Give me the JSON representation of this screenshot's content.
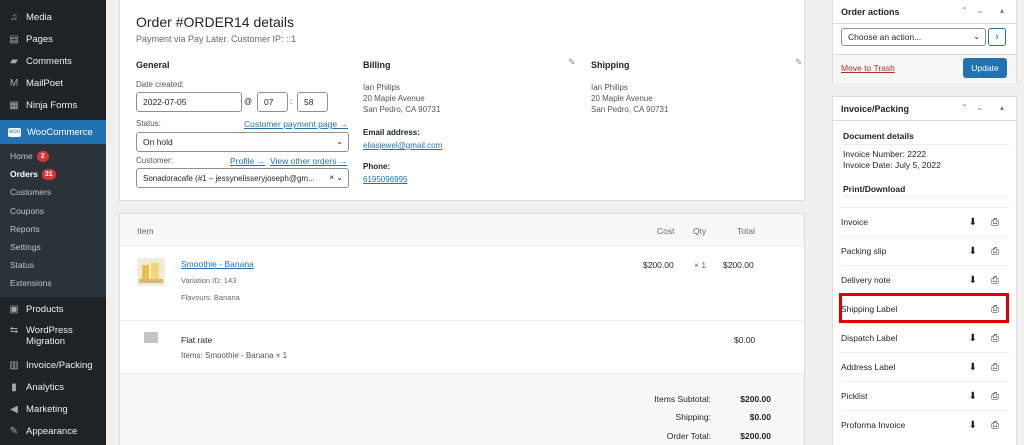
{
  "sidebar": {
    "items": [
      {
        "icon": "media-icon",
        "label": "Media"
      },
      {
        "icon": "pages-icon",
        "label": "Pages"
      },
      {
        "icon": "comments-icon",
        "label": "Comments"
      },
      {
        "icon": "mailpoet-icon",
        "label": "MailPoet"
      },
      {
        "icon": "forms-icon",
        "label": "Ninja Forms"
      },
      {
        "icon": "woocommerce-icon",
        "label": "WooCommerce"
      }
    ],
    "woo_sub": [
      {
        "label": "Home",
        "badge": "2"
      },
      {
        "label": "Orders",
        "badge": "31"
      },
      {
        "label": "Customers"
      },
      {
        "label": "Coupons"
      },
      {
        "label": "Reports"
      },
      {
        "label": "Settings"
      },
      {
        "label": "Status"
      },
      {
        "label": "Extensions"
      }
    ],
    "after": [
      {
        "icon": "products-icon",
        "label": "Products"
      },
      {
        "icon": "migration-icon",
        "label": "WordPress Migration"
      },
      {
        "icon": "invoice-icon",
        "label": "Invoice/Packing"
      },
      {
        "icon": "analytics-icon",
        "label": "Analytics"
      },
      {
        "icon": "marketing-icon",
        "label": "Marketing"
      },
      {
        "icon": "appearance-icon",
        "label": "Appearance"
      }
    ]
  },
  "order": {
    "title": "Order #ORDER14 details",
    "subtitle": "Payment via Pay Later. Customer IP: ::1",
    "general": {
      "heading": "General",
      "date_label": "Date created:",
      "date": "2022-07-05",
      "at": "@",
      "hour": "07",
      "colon": ":",
      "minute": "58",
      "status_label": "Status:",
      "customer_payment_link": "Customer payment page →",
      "status": "On hold",
      "customer_label": "Customer:",
      "profile_link": "Profile →",
      "other_orders_link": "View other orders →",
      "customer": "Sonadoracafe (#1 – jessynelisseryjoseph@gm...",
      "clear": "×"
    },
    "billing": {
      "heading": "Billing",
      "name": "Ian Philips",
      "street": "20 Maple Avenue",
      "city": "San Pedro, CA 90731",
      "email_label": "Email address:",
      "email": "eliasjewel@gmail.com",
      "phone_label": "Phone:",
      "phone": "6195096995"
    },
    "shipping": {
      "heading": "Shipping",
      "name": "Ian Philips",
      "street": "20 Maple Avenue",
      "city": "San Pedro, CA 90731"
    }
  },
  "items": {
    "headers": {
      "item": "Item",
      "cost": "Cost",
      "qty": "Qty",
      "total": "Total"
    },
    "product": {
      "name": "Smoothie - Banana",
      "variation": "Variation ID: 143",
      "attr": "Flavours: Banana",
      "cost": "$200.00",
      "qty": "× 1",
      "total": "$200.00"
    },
    "shipping_line": {
      "name": "Flat rate",
      "items": "Items: Smoothie - Banana × 1",
      "total": "$0.00"
    },
    "totals": [
      {
        "label": "Items Subtotal:",
        "value": "$200.00"
      },
      {
        "label": "Shipping:",
        "value": "$0.00"
      },
      {
        "label": "Order Total:",
        "value": "$200.00"
      }
    ]
  },
  "order_actions": {
    "title": "Order actions",
    "select": "Choose an action...",
    "go": "›",
    "trash": "Move to Trash",
    "update": "Update"
  },
  "invoice_packing": {
    "title": "Invoice/Packing",
    "doc_details": "Document details",
    "invoice_number": "Invoice Number: 2222",
    "invoice_date": "Invoice Date: July 5, 2022",
    "print_download": "Print/Download",
    "docs": [
      {
        "label": "Invoice",
        "download": true
      },
      {
        "label": "Packing slip",
        "download": true
      },
      {
        "label": "Delivery note",
        "download": true
      },
      {
        "label": "Shipping Label",
        "download": false
      },
      {
        "label": "Dispatch Label",
        "download": true
      },
      {
        "label": "Address Label",
        "download": true
      },
      {
        "label": "Picklist",
        "download": true
      },
      {
        "label": "Proforma Invoice",
        "download": true
      }
    ]
  },
  "colors": {
    "accent": "#2271b1",
    "sidebar": "#1d2327",
    "badge": "#d63638",
    "highlight": "#e00000",
    "trash": "#b32d2e"
  }
}
